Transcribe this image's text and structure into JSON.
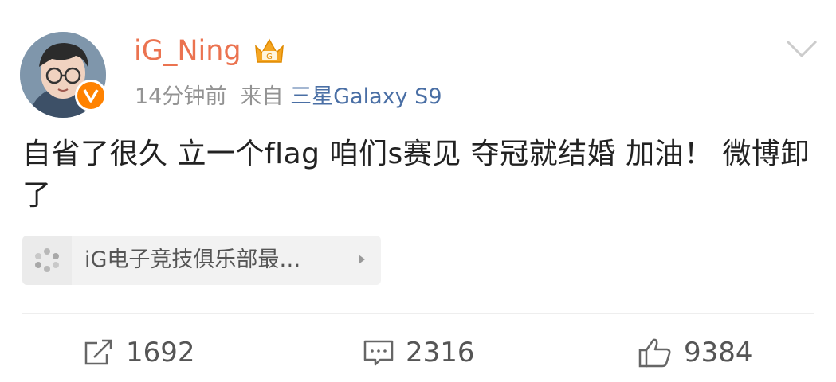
{
  "post": {
    "username": "iG_Ning",
    "time": "14分钟前",
    "source_prefix": "来自",
    "device": "三星Galaxy S9",
    "content": "自省了很久 立一个flag 咱们s赛见 夺冠就结婚 加油！ 微博卸了",
    "topic_card": {
      "label": "iG电子竞技俱乐部最…"
    }
  },
  "actions": {
    "reposts": "1692",
    "comments": "2316",
    "likes": "9384"
  },
  "colors": {
    "username": "#eb7350",
    "device_link": "#4a6fa5",
    "verified_badge": "#ff8200",
    "crown": "#f5a623"
  },
  "icons": [
    "avatar",
    "verified-v-icon",
    "crown-member-icon",
    "chevron-down-icon",
    "topic-sparkle-icon",
    "arrow-right-icon",
    "repost-icon",
    "comment-icon",
    "like-icon"
  ]
}
